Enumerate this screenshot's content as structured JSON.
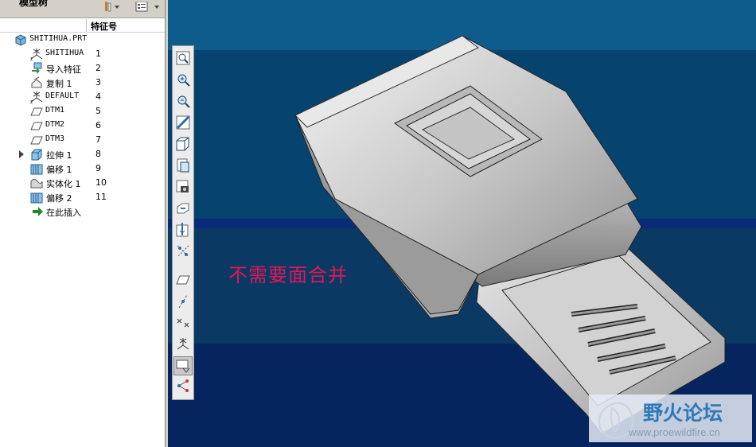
{
  "tree_panel": {
    "title": "模型树",
    "column_header": "特征号",
    "root": "SHITIHUA.PRT",
    "items": [
      {
        "label": "SHITIHUA",
        "num": "1",
        "icon": "csys-icon"
      },
      {
        "label": "导入特征",
        "num": "2",
        "icon": "import-feature-icon"
      },
      {
        "label": "复制 1",
        "num": "3",
        "icon": "copy-icon"
      },
      {
        "label": "DEFAULT",
        "num": "4",
        "icon": "csys-icon"
      },
      {
        "label": "DTM1",
        "num": "5",
        "icon": "datum-plane-icon"
      },
      {
        "label": "DTM2",
        "num": "6",
        "icon": "datum-plane-icon"
      },
      {
        "label": "DTM3",
        "num": "7",
        "icon": "datum-plane-icon"
      },
      {
        "label": "拉伸 1",
        "num": "8",
        "icon": "extrude-icon"
      },
      {
        "label": "偏移 1",
        "num": "9",
        "icon": "offset-icon"
      },
      {
        "label": "实体化 1",
        "num": "10",
        "icon": "solidify-icon"
      },
      {
        "label": "偏移 2",
        "num": "11",
        "icon": "offset-icon"
      },
      {
        "label": "在此插入",
        "num": "",
        "icon": "insert-here-arrow-icon"
      }
    ]
  },
  "viewport": {
    "annotation": "不需要面合并",
    "background_colors": [
      "#0e5c8c",
      "#06436e",
      "#0a2c78",
      "#06245e"
    ]
  },
  "toolbar_icons": [
    "zoom-refit-icon",
    "zoom-in-icon",
    "zoom-out-icon",
    "repaint-icon",
    "orient-icon",
    "saved-views-icon",
    "layers-icon",
    "spin-center-icon",
    "datum-axis-display-icon",
    "datum-point-display-icon",
    "datum-plane-display-icon",
    "axis-on-off-icon",
    "point-on-off-icon",
    "csys-on-off-icon",
    "annotation-display-icon",
    "model-tree-toggle-icon"
  ],
  "watermark": {
    "title": "野火论坛",
    "url": "www.proewildfire.cn"
  },
  "colors": {
    "annotation": "#e0175a",
    "brand": "#2f79b8"
  }
}
